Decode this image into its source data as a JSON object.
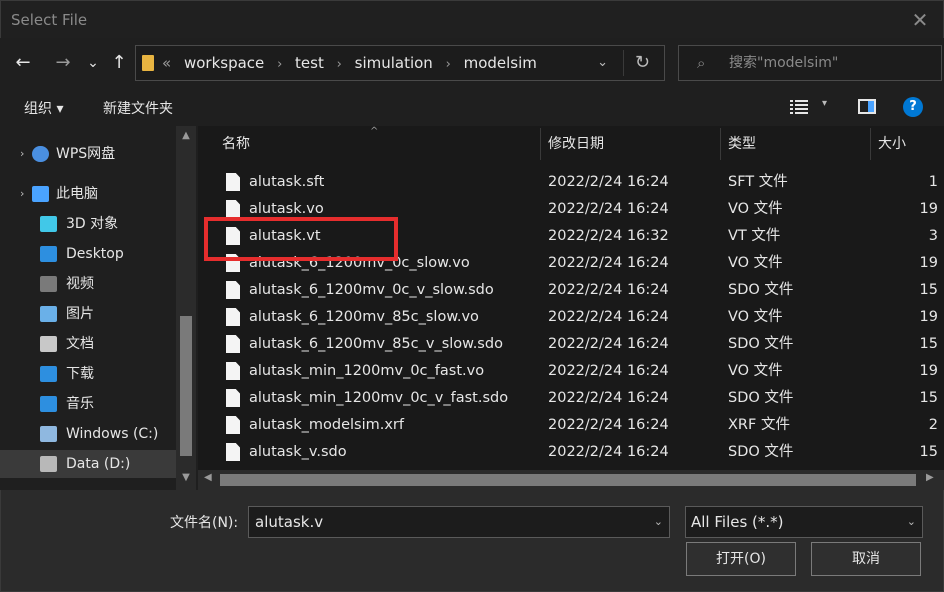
{
  "window": {
    "title": "Select File",
    "close_glyph": "✕"
  },
  "nav": {
    "back": "←",
    "forward": "→",
    "recent": "⌄",
    "up": "↑",
    "breadcrumb_lead": "«",
    "crumbs": [
      "workspace",
      "test",
      "simulation",
      "modelsim"
    ],
    "address_dropdown": "⌄",
    "refresh": "↻",
    "search_icon": "⌕",
    "search_placeholder": "搜索\"modelsim\""
  },
  "toolbar": {
    "organize": "组织 ▾",
    "new_folder": "新建文件夹",
    "view_dropdown": "▾",
    "help": "?"
  },
  "sidebar": {
    "items": [
      {
        "label": "WPS网盘",
        "icon": "cloud-icon",
        "color": "#4a8fe0"
      },
      {
        "label": "此电脑",
        "icon": "pc-icon",
        "color": "#4aa3ff"
      },
      {
        "label": "3D 对象",
        "icon": "cube-icon",
        "color": "#41c8e8"
      },
      {
        "label": "Desktop",
        "icon": "desktop-icon",
        "color": "#2d8fe0"
      },
      {
        "label": "视频",
        "icon": "video-icon",
        "color": "#7a7a7a"
      },
      {
        "label": "图片",
        "icon": "picture-icon",
        "color": "#6ab0e8"
      },
      {
        "label": "文档",
        "icon": "document-icon",
        "color": "#c8c8c8"
      },
      {
        "label": "下载",
        "icon": "download-icon",
        "color": "#2d8fe0"
      },
      {
        "label": "音乐",
        "icon": "music-icon",
        "color": "#2d8fe0"
      },
      {
        "label": "Windows (C:)",
        "icon": "drive-c-icon",
        "color": "#8fb8e0"
      },
      {
        "label": "Data (D:)",
        "icon": "drive-d-icon",
        "color": "#b8b8b8"
      }
    ],
    "expand_arrow": "›"
  },
  "columns": {
    "name": "名称",
    "date": "修改日期",
    "type": "类型",
    "size": "大小",
    "sort_glyph": "^"
  },
  "files": [
    {
      "name": "alutask.sft",
      "date": "2022/2/24 16:24",
      "type": "SFT 文件",
      "size": "1"
    },
    {
      "name": "alutask.vo",
      "date": "2022/2/24 16:24",
      "type": "VO 文件",
      "size": "19"
    },
    {
      "name": "alutask.vt",
      "date": "2022/2/24 16:32",
      "type": "VT 文件",
      "size": "3"
    },
    {
      "name": "alutask_6_1200mv_0c_slow.vo",
      "date": "2022/2/24 16:24",
      "type": "VO 文件",
      "size": "19"
    },
    {
      "name": "alutask_6_1200mv_0c_v_slow.sdo",
      "date": "2022/2/24 16:24",
      "type": "SDO 文件",
      "size": "15"
    },
    {
      "name": "alutask_6_1200mv_85c_slow.vo",
      "date": "2022/2/24 16:24",
      "type": "VO 文件",
      "size": "19"
    },
    {
      "name": "alutask_6_1200mv_85c_v_slow.sdo",
      "date": "2022/2/24 16:24",
      "type": "SDO 文件",
      "size": "15"
    },
    {
      "name": "alutask_min_1200mv_0c_fast.vo",
      "date": "2022/2/24 16:24",
      "type": "VO 文件",
      "size": "19"
    },
    {
      "name": "alutask_min_1200mv_0c_v_fast.sdo",
      "date": "2022/2/24 16:24",
      "type": "SDO 文件",
      "size": "15"
    },
    {
      "name": "alutask_modelsim.xrf",
      "date": "2022/2/24 16:24",
      "type": "XRF 文件",
      "size": "2"
    },
    {
      "name": "alutask_v.sdo",
      "date": "2022/2/24 16:24",
      "type": "SDO 文件",
      "size": "15"
    }
  ],
  "scroll": {
    "up": "▲",
    "down": "▼",
    "left": "◀",
    "right": "▶"
  },
  "footer": {
    "filename_label": "文件名(N):",
    "filename_value": "alutask.v",
    "filename_dropdown": "⌄",
    "filetype_value": "All Files (*.*)",
    "filetype_dropdown": "⌄",
    "open_button": "打开(O)",
    "cancel_button": "取消"
  },
  "colors": {
    "highlight_box": "#e62d2d",
    "accent": "#0078d4"
  }
}
